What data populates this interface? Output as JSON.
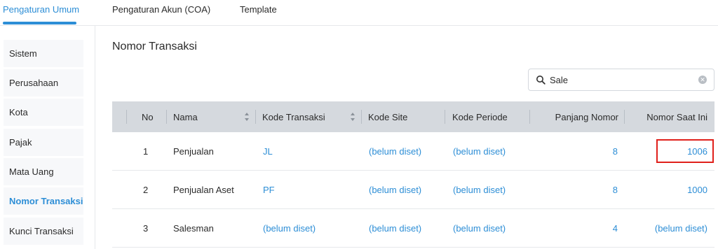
{
  "tabs": [
    {
      "label": "Pengaturan Umum",
      "active": true
    },
    {
      "label": "Pengaturan Akun (COA)",
      "active": false
    },
    {
      "label": "Template",
      "active": false
    }
  ],
  "sidebar": {
    "items": [
      {
        "label": "Sistem"
      },
      {
        "label": "Perusahaan"
      },
      {
        "label": "Kota"
      },
      {
        "label": "Pajak"
      },
      {
        "label": "Mata Uang"
      },
      {
        "label": "Nomor Transaksi",
        "active": true
      },
      {
        "label": "Kunci Transaksi"
      }
    ]
  },
  "page": {
    "title": "Nomor Transaksi"
  },
  "search": {
    "value": "Sale",
    "icon": "search-icon",
    "clear_icon": "clear-icon"
  },
  "table": {
    "headers": [
      "No",
      "Nama",
      "Kode Transaksi",
      "Kode Site",
      "Kode Periode",
      "Panjang Nomor",
      "Nomor Saat Ini"
    ],
    "rows": [
      {
        "no": "1",
        "nama": "Penjualan",
        "kode_transaksi": "JL",
        "kode_site": "(belum diset)",
        "kode_periode": "(belum diset)",
        "panjang_nomor": "8",
        "nomor_saat_ini": "1006"
      },
      {
        "no": "2",
        "nama": "Penjualan Aset",
        "kode_transaksi": "PF",
        "kode_site": "(belum diset)",
        "kode_periode": "(belum diset)",
        "panjang_nomor": "8",
        "nomor_saat_ini": "1000"
      },
      {
        "no": "3",
        "nama": "Salesman",
        "kode_transaksi": "(belum diset)",
        "kode_site": "(belum diset)",
        "kode_periode": "(belum diset)",
        "panjang_nomor": "4",
        "nomor_saat_ini": "(belum diset)"
      }
    ]
  },
  "colors": {
    "accent": "#2d8ed6",
    "header_bg": "#d5d9de",
    "highlight": "#e0201b",
    "sidebar_bg": "#f7f8fa"
  }
}
